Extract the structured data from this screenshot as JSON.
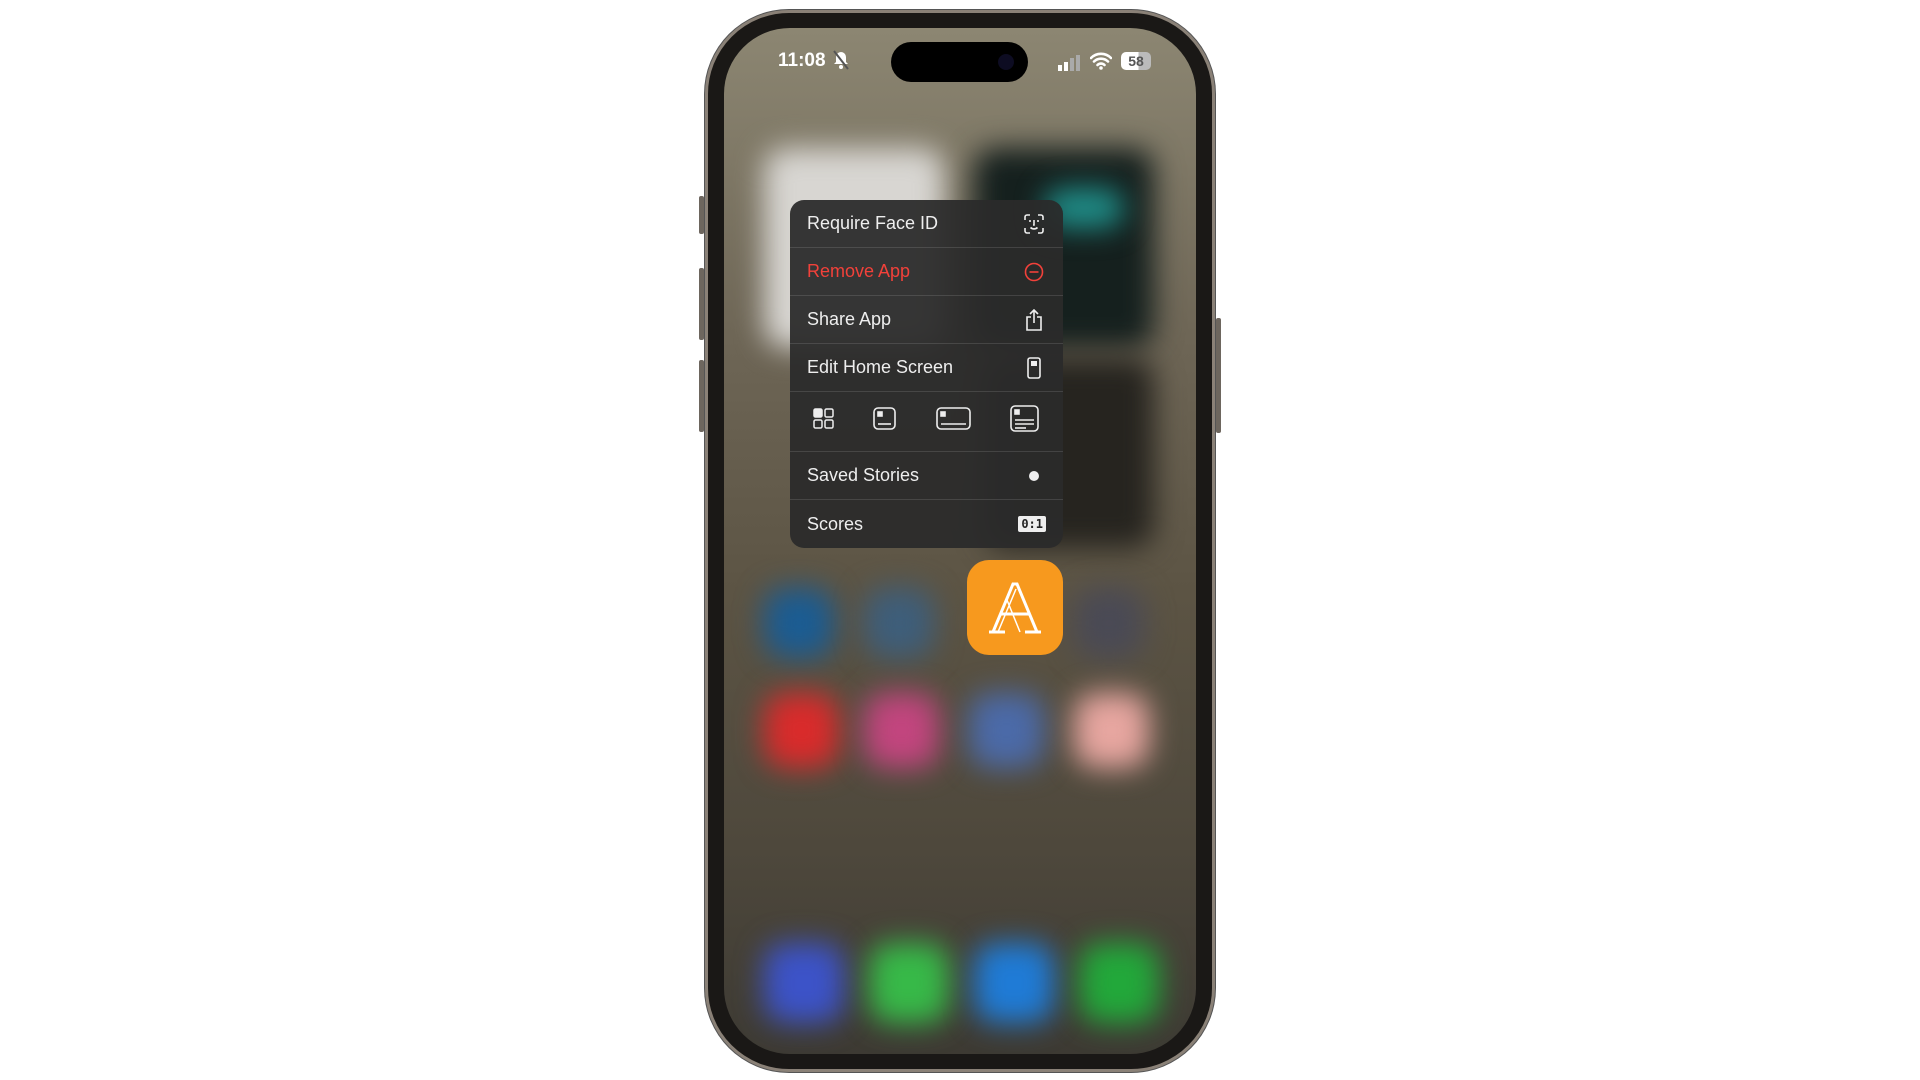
{
  "status_bar": {
    "time": "11:08",
    "battery": "58",
    "icons": [
      "bell-slash-icon",
      "cellular-signal-icon",
      "wifi-icon",
      "battery-icon"
    ]
  },
  "menu": {
    "items": [
      {
        "label": "Require Face ID",
        "icon": "face-id-icon"
      },
      {
        "label": "Remove App",
        "icon": "minus-circle-icon",
        "color": "#f2413a"
      },
      {
        "label": "Share App",
        "icon": "share-icon"
      },
      {
        "label": "Edit Home Screen",
        "icon": "phone-apps-icon"
      }
    ],
    "widget_sizes": [
      "app-icon-size",
      "small-widget",
      "medium-widget",
      "large-widget"
    ],
    "widgets": [
      {
        "label": "Saved Stories",
        "icon": "dot-icon"
      },
      {
        "label": "Scores",
        "icon": "scoreboard-icon",
        "icon_text": "0:1"
      }
    ]
  },
  "app": {
    "icon": "athletic-a-logo",
    "letter": "A",
    "color": "#f7991e"
  }
}
